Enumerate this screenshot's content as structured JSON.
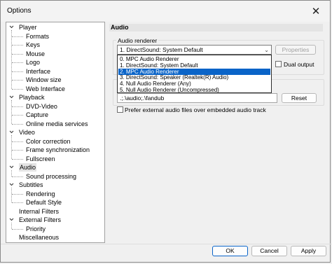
{
  "window": {
    "title": "Options",
    "close_glyph": "✕"
  },
  "tree": [
    {
      "label": "Player",
      "level": 0,
      "expander": true
    },
    {
      "label": "Formats",
      "level": 1
    },
    {
      "label": "Keys",
      "level": 1
    },
    {
      "label": "Mouse",
      "level": 1
    },
    {
      "label": "Logo",
      "level": 1
    },
    {
      "label": "Interface",
      "level": 1
    },
    {
      "label": "Window size",
      "level": 1
    },
    {
      "label": "Web Interface",
      "level": 1
    },
    {
      "label": "Playback",
      "level": 0,
      "expander": true
    },
    {
      "label": "DVD-Video",
      "level": 1
    },
    {
      "label": "Capture",
      "level": 1
    },
    {
      "label": "Online media services",
      "level": 1
    },
    {
      "label": "Video",
      "level": 0,
      "expander": true
    },
    {
      "label": "Color correction",
      "level": 1
    },
    {
      "label": "Frame synchronization",
      "level": 1
    },
    {
      "label": "Fullscreen",
      "level": 1
    },
    {
      "label": "Audio",
      "level": 0,
      "expander": true,
      "selected": true
    },
    {
      "label": "Sound processing",
      "level": 1
    },
    {
      "label": "Subtitles",
      "level": 0,
      "expander": true
    },
    {
      "label": "Rendering",
      "level": 1
    },
    {
      "label": "Default Style",
      "level": 1
    },
    {
      "label": "Internal Filters",
      "level": 0
    },
    {
      "label": "External Filters",
      "level": 0,
      "expander": true
    },
    {
      "label": "Priority",
      "level": 1
    },
    {
      "label": "Miscellaneous",
      "level": 0
    }
  ],
  "audio": {
    "header": "Audio",
    "renderer_group": "Audio renderer",
    "renderer_value": "1. DirectSound: System Default",
    "options": [
      "0. MPC Audio Renderer",
      "1. DirectSound: System Default",
      "2. MPC Audio Renderer",
      "3. DirectSound: Speaker (Realtek(R) Audio)",
      "4. Null Audio Renderer (Any)",
      "5. Null Audio Renderer (Uncompressed)"
    ],
    "selected_option_index": 2,
    "properties_label": "Properties",
    "dual_output_label": "Dual output",
    "paths_value": ".;.\\audio;.\\fandub",
    "reset_label": "Reset",
    "prefer_external_label": "Prefer external audio files over embedded audio track"
  },
  "footer": {
    "ok": "OK",
    "cancel": "Cancel",
    "apply": "Apply"
  },
  "colors": {
    "selection": "#0a64c8",
    "header_bg": "#e4e4e4"
  }
}
